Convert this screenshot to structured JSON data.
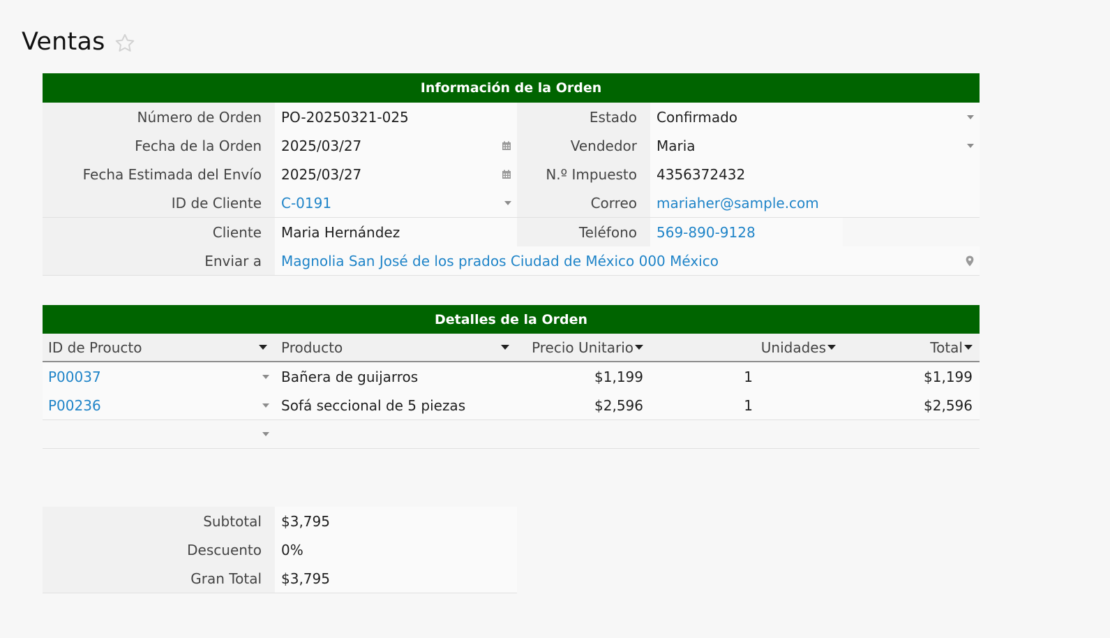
{
  "page": {
    "title": "Ventas",
    "star_icon": "star-outline-icon"
  },
  "order_info": {
    "title": "Información de la Orden",
    "rows": [
      {
        "label": "Número de Orden",
        "value": "PO-20250321-025",
        "right_label": "Estado",
        "right_value": "Confirmado"
      },
      {
        "label": "Fecha de la Orden",
        "value": "2025/03/27",
        "right_label": "Vendedor",
        "right_value": "Maria"
      },
      {
        "label": "Fecha Estimada del Envío",
        "value": "2025/03/27",
        "right_label": "N.º Impuesto",
        "right_value": "4356372432"
      },
      {
        "label": "ID de Cliente",
        "value": "C-0191",
        "right_label": "Correo",
        "right_value": "mariaher@sample.com"
      },
      {
        "label": "Cliente",
        "value": "Maria Hernández",
        "right_label": "Teléfono",
        "right_value": "569-890-9128"
      },
      {
        "label": "Enviar a",
        "value": "Magnolia San José de los prados Ciudad de México 000 México"
      }
    ]
  },
  "order_details": {
    "title": "Detalles de la Orden",
    "columns": [
      "ID de Proucto",
      "Producto",
      "Precio Unitario",
      "Unidades",
      "Total"
    ],
    "rows": [
      {
        "product_id": "P00037",
        "product": "Bañera de guijarros",
        "unit_price": "$1,199",
        "units": "1",
        "total": "$1,199"
      },
      {
        "product_id": "P00236",
        "product": "Sofá seccional de 5 piezas",
        "unit_price": "$2,596",
        "units": "1",
        "total": "$2,596"
      }
    ]
  },
  "summary": {
    "rows": [
      {
        "label": "Subtotal",
        "value": "$3,795"
      },
      {
        "label": "Descuento",
        "value": "0%"
      },
      {
        "label": "Gran Total",
        "value": "$3,795"
      }
    ]
  },
  "colors": {
    "header_green": "#006400",
    "link_blue": "#1f84c8"
  }
}
